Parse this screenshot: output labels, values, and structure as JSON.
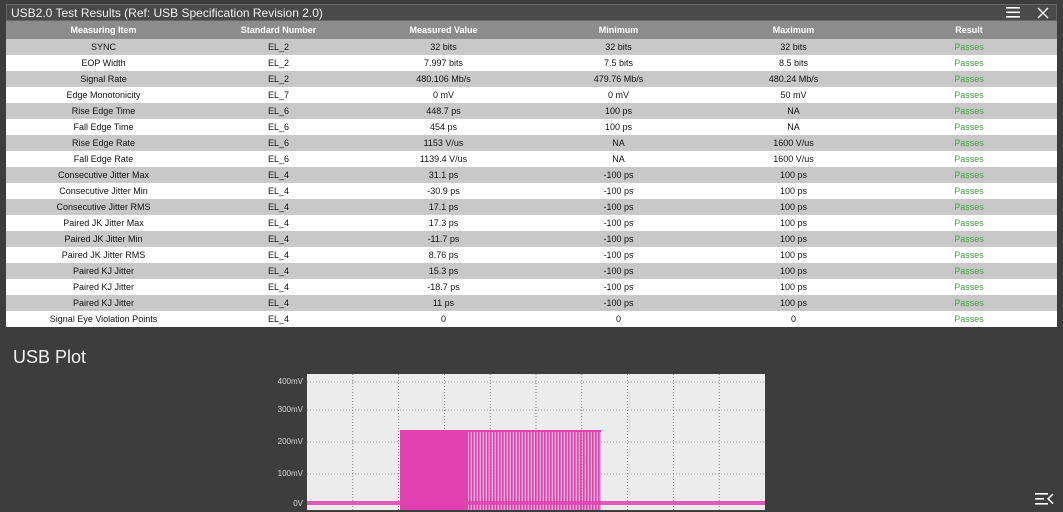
{
  "window": {
    "title": "USB2.0 Test Results (Ref: USB Specification Revision 2.0)",
    "menu_icon": "hamburger-menu-icon",
    "close_icon": "close-icon"
  },
  "table": {
    "headers": [
      "Measuring Item",
      "Standard Number",
      "Measured Value",
      "Minimum",
      "Maximum",
      "Result"
    ],
    "rows": [
      [
        "SYNC",
        "EL_2",
        "32 bits",
        "32 bits",
        "32 bits",
        "Passes"
      ],
      [
        "EOP Width",
        "EL_2",
        "7.997 bits",
        "7.5 bits",
        "8.5 bits",
        "Passes"
      ],
      [
        "Signal Rate",
        "EL_2",
        "480.106 Mb/s",
        "479.76 Mb/s",
        "480.24 Mb/s",
        "Passes"
      ],
      [
        "Edge Monotonicity",
        "EL_7",
        "0 mV",
        "0 mV",
        "50 mV",
        "Passes"
      ],
      [
        "Rise Edge Time",
        "EL_6",
        "448.7 ps",
        "100 ps",
        "NA",
        "Passes"
      ],
      [
        "Fall Edge Time",
        "EL_6",
        "454 ps",
        "100 ps",
        "NA",
        "Passes"
      ],
      [
        "Rise Edge Rate",
        "EL_6",
        "1153 V/us",
        "NA",
        "1600 V/us",
        "Passes"
      ],
      [
        "Fall Edge Rate",
        "EL_6",
        "1139.4 V/us",
        "NA",
        "1600 V/us",
        "Passes"
      ],
      [
        "Consecutive Jitter Max",
        "EL_4",
        "31.1 ps",
        "-100 ps",
        "100 ps",
        "Passes"
      ],
      [
        "Consecutive Jitter Min",
        "EL_4",
        "-30.9 ps",
        "-100 ps",
        "100 ps",
        "Passes"
      ],
      [
        "Consecutive Jitter RMS",
        "EL_4",
        "17.1 ps",
        "-100 ps",
        "100 ps",
        "Passes"
      ],
      [
        "Paired JK Jitter Max",
        "EL_4",
        "17.3 ps",
        "-100 ps",
        "100 ps",
        "Passes"
      ],
      [
        "Paired JK Jitter Min",
        "EL_4",
        "-11.7 ps",
        "-100 ps",
        "100 ps",
        "Passes"
      ],
      [
        "Paired JK Jitter RMS",
        "EL_4",
        "8.76 ps",
        "-100 ps",
        "100 ps",
        "Passes"
      ],
      [
        "Paired KJ Jitter",
        "EL_4",
        "15.3 ps",
        "-100 ps",
        "100 ps",
        "Passes"
      ],
      [
        "Paired KJ Jitter",
        "EL_4",
        "-18.7 ps",
        "-100 ps",
        "100 ps",
        "Passes"
      ],
      [
        "Paired KJ Jitter",
        "EL_4",
        "11 ps",
        "-100 ps",
        "100 ps",
        "Passes"
      ],
      [
        "Signal Eye Violation Points",
        "EL_4",
        "0",
        "0",
        "0",
        "Passes"
      ]
    ]
  },
  "plot": {
    "title": "USB Plot",
    "y_ticks": [
      "400mV",
      "300mV",
      "200mV",
      "100mV",
      "0V"
    ],
    "signal_color": "#e040b0"
  },
  "colors": {
    "pass": "#3aa63a"
  }
}
